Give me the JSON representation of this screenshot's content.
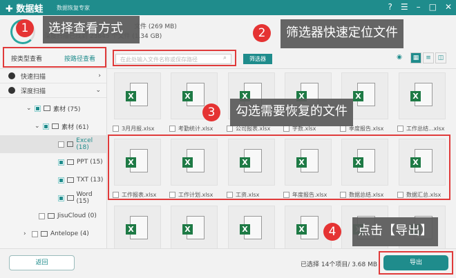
{
  "app": {
    "logo": "数据蛙",
    "subtitle": "数据恢复专家",
    "controls": [
      "?",
      "☰",
      "–",
      "□",
      "✕"
    ]
  },
  "header": {
    "line1": "文件 (269 MB)",
    "line2": "深度扫描已找到 23845 个文件 (1.34 GB)"
  },
  "sidebar": {
    "view_by_type": "按类型查看",
    "view_by_path": "按路径查看",
    "quick_scan": "快速扫描",
    "deep_scan": "深度扫描",
    "tree": [
      {
        "label": "素材 (75)",
        "indent": 38,
        "arrow": "⌄",
        "checked": true
      },
      {
        "label": "素材 (61)",
        "indent": 50,
        "arrow": "⌄",
        "checked": true
      },
      {
        "label": "Excel (18)",
        "indent": 72,
        "arrow": "",
        "checked": false,
        "selected": true
      },
      {
        "label": "PPT (15)",
        "indent": 72,
        "arrow": "",
        "checked": true
      },
      {
        "label": "TXT (13)",
        "indent": 72,
        "arrow": "",
        "checked": true
      },
      {
        "label": "Word (15)",
        "indent": 72,
        "arrow": "",
        "checked": true
      },
      {
        "label": "JisuCloud (0)",
        "indent": 44,
        "arrow": "",
        "checked": false
      },
      {
        "label": "Antelope (4)",
        "indent": 34,
        "arrow": "›",
        "checked": false
      }
    ]
  },
  "toolbar": {
    "search_placeholder": "在此处输入文件名称或保存路径",
    "filter_label": "筛选器",
    "views": [
      "▦",
      "≡",
      "◫"
    ]
  },
  "files": {
    "row1": [
      "3月月报.xlsx",
      "考勤统计.xlsx",
      "公司报表.xlsx",
      "字数.xlsx",
      "季度报告.xlsx",
      "工作总结...xlsx"
    ],
    "row2": [
      "工作报表.xlsx",
      "工作计划.xlsx",
      "工资.xlsx",
      "年度报告.xlsx",
      "数据总结.xlsx",
      "数据汇总.xlsx"
    ],
    "row3_count": 6,
    "icon_letter": "X"
  },
  "footer": {
    "back_label": "返回",
    "status": "已选择 14个项目/ 3.68 MB",
    "export_label": "导出"
  },
  "annotations": [
    {
      "num": "1",
      "text": "选择查看方式"
    },
    {
      "num": "2",
      "text": "筛选器快速定位文件"
    },
    {
      "num": "3",
      "text": "勾选需要恢复的文件"
    },
    {
      "num": "4",
      "text": "点击【导出】"
    }
  ],
  "colors": {
    "accent": "#1f8c8c",
    "annotation_red": "#e53333"
  }
}
